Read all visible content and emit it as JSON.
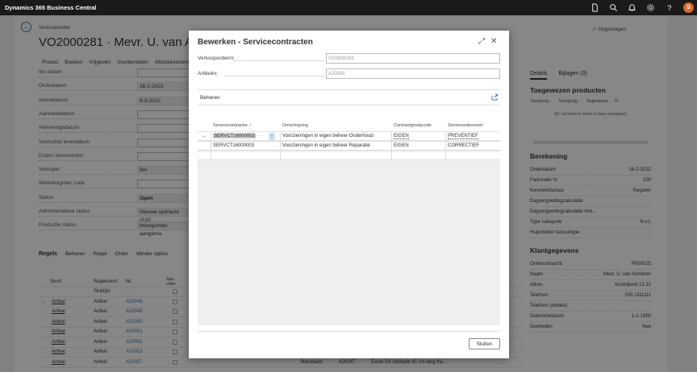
{
  "app": {
    "title": "Dynamics 365 Business Central",
    "avatar_initial": "S",
    "icons": [
      "document-icon",
      "search-icon",
      "bell-icon",
      "gear-icon",
      "help-icon"
    ]
  },
  "background": {
    "caption": "Verkooporder",
    "title": "VO2000281 · Mevr. U. van Achter",
    "saved": "✓ Opgeslagen",
    "actions": [
      "Proces",
      "Boeken",
      "Vrijgeven",
      "Voorbereiden",
      "Afdrukken/verze"
    ],
    "fields": [
      {
        "label": "ltin-datum",
        "value": ""
      },
      {
        "label": "Orderdatum",
        "value": "16-2-2022"
      },
      {
        "label": "Vervaldatum",
        "value": "9-3-2022"
      },
      {
        "label": "Aanmeetdatum",
        "value": ""
      },
      {
        "label": "Afleveringsdatum",
        "value": ""
      },
      {
        "label": "Verzochte leverdatum",
        "value": ""
      },
      {
        "label": "Extern documentnr.",
        "value": ""
      },
      {
        "label": "Verkoper",
        "value": "BH"
      },
      {
        "label": "Winkelregister code",
        "value": ""
      },
      {
        "label": "Status",
        "value": "Open"
      },
      {
        "label": "Administratieve status",
        "value": "Nieuwe opdracht (A10"
      },
      {
        "label": "Productie status",
        "value": "Inkooporder aangema"
      }
    ],
    "lines_header": {
      "title": "Regels",
      "actions": [
        "Beheren",
        "Regel",
        "Order",
        "Minder opties"
      ]
    },
    "lines_columns": [
      "Soort",
      "Regelsoort",
      "Nr.",
      "Spe... order"
    ],
    "lines": [
      {
        "soort": "",
        "regelsoort": "Stuklijst",
        "nr": "..."
      },
      {
        "soort": "Artikel",
        "regelsoort": "Artikel",
        "nr": "A20048"
      },
      {
        "soort": "Artikel",
        "regelsoort": "Artikel",
        "nr": "A20049"
      },
      {
        "soort": "Artikel",
        "regelsoort": "Artikel",
        "nr": "A20050"
      },
      {
        "soort": "Artikel",
        "regelsoort": "Artikel",
        "nr": "A20051"
      },
      {
        "soort": "Artikel",
        "regelsoort": "Artikel",
        "nr": "A20052"
      },
      {
        "soort": "Artikel",
        "regelsoort": "Artikel",
        "nr": "A20053"
      },
      {
        "soort": "Artikel",
        "regelsoort": "Artikel",
        "nr": "A20057"
      }
    ],
    "last_line_extra": {
      "col1": "Standaard",
      "col2": "A20047",
      "col3": "Excel G4 zitdiepte 45 cm lang fra..."
    },
    "right_panel": {
      "tabs": [
        "Details",
        "Bijlagen (0)"
      ],
      "assigned_title": "Toegewezen producten",
      "assigned_columns": [
        "Toewijzing...",
        "Toewijzing...",
        "Begindatum",
        "Pr"
      ],
      "assigned_empty": "(Er valt niets te tonen in deze weergave)",
      "calc_title": "Berekening",
      "calc_rows": [
        {
          "label": "Orderdatum",
          "value": "16-2-2022"
        },
        {
          "label": "Facturatie %",
          "value": "100"
        },
        {
          "label": "Kenmerkfactuur",
          "value": "Regulier"
        },
        {
          "label": "Dagvergoedingcalculatie",
          "value": ""
        },
        {
          "label": "Dagvergoedingcalculatie met...",
          "value": ""
        },
        {
          "label": "Type categorie",
          "value": "N.v.t."
        },
        {
          "label": "Hulpmiddel factuurtype",
          "value": ""
        }
      ],
      "customer_title": "Klantgegevens",
      "customer_rows": [
        {
          "label": "Ordercontactnr.",
          "value": "P000025"
        },
        {
          "label": "Naam",
          "value": "Mevr. U. van Achteren"
        },
        {
          "label": "Adres",
          "value": "Kostrijland 12 12"
        },
        {
          "label": "Telefoon",
          "value": "035 1111111"
        },
        {
          "label": "Telefoon (mobiel)",
          "value": ""
        },
        {
          "label": "Geboortedatum",
          "value": "1-1-1950"
        },
        {
          "label": "Overleden",
          "value": "Nee"
        }
      ]
    }
  },
  "dialog": {
    "title": "Bewerken - Servicecontracten",
    "fields": [
      {
        "label": "Verkoopordernr.",
        "value": "VO2000281"
      },
      {
        "label": "Artikelnr.",
        "value": "A20045"
      }
    ],
    "beheren": "Beheren",
    "columns": [
      "Servicecontractnr. ↑",
      "Omschrijving",
      "Contractgroepcode",
      "Serviceordersoort"
    ],
    "rows": [
      {
        "nr": "SERVCT16000002",
        "omschrijving": "Voorzieningen in eigen beheer Onderhoud",
        "groep": "EIGEN",
        "soort": "PREVENTIEF"
      },
      {
        "nr": "SERVCT16000003",
        "omschrijving": "Voorzieningen in eigen beheer Reparatie",
        "groep": "EIGEN",
        "soort": "CORRECTIEF"
      }
    ],
    "close_label": "Sluiten"
  }
}
